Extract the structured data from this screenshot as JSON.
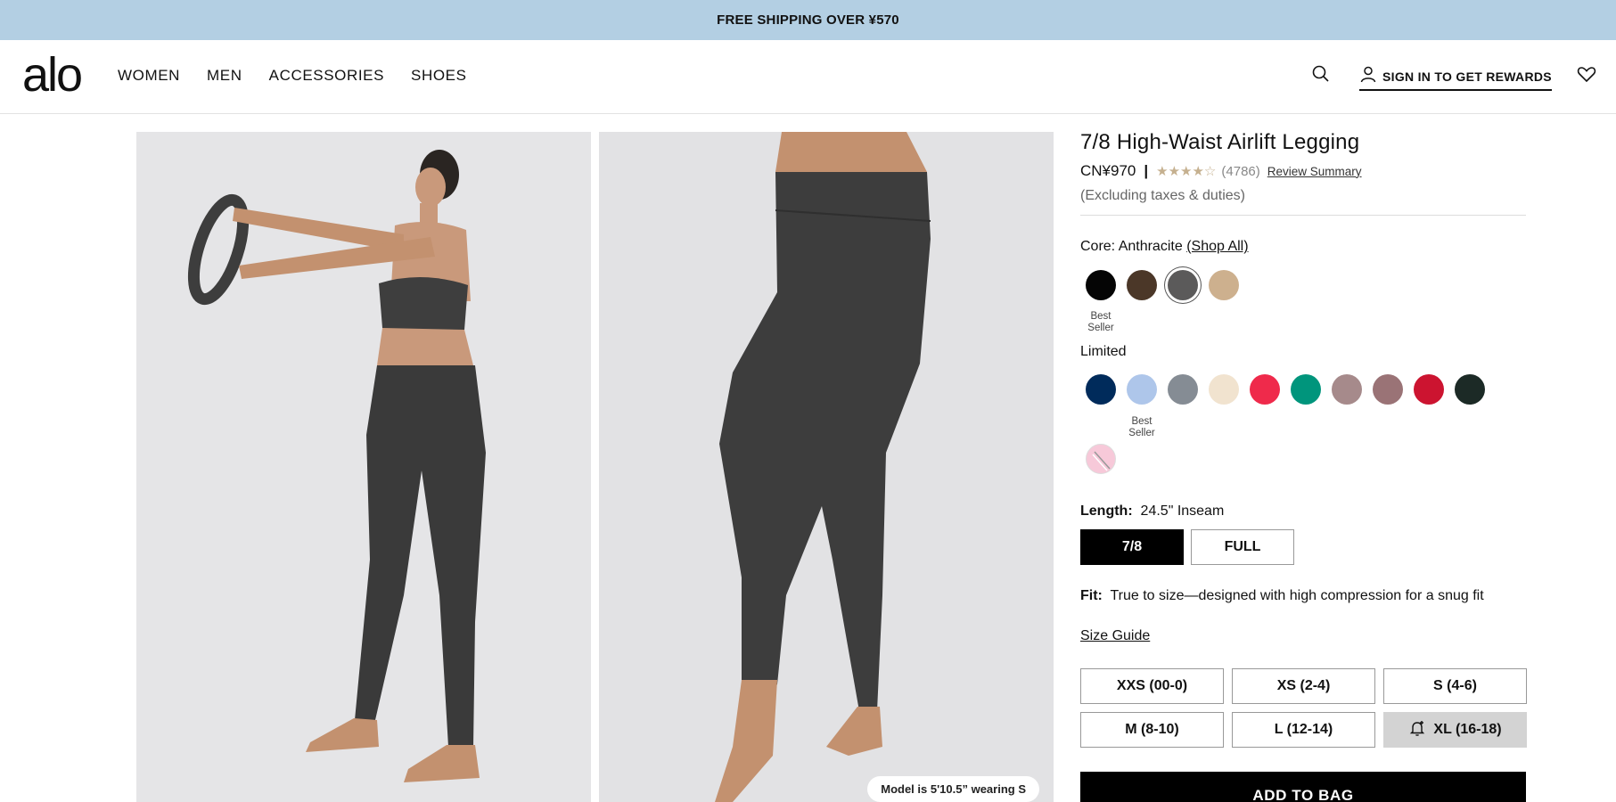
{
  "promo": {
    "text": "FREE SHIPPING OVER ¥570"
  },
  "header": {
    "logo": "alo",
    "nav": [
      "WOMEN",
      "MEN",
      "ACCESSORIES",
      "SHOES"
    ],
    "signin": "SIGN IN TO GET REWARDS"
  },
  "gallery": {
    "model_note": "Model is 5'10.5” wearing S"
  },
  "product": {
    "name": "7/8 High-Waist Airlift Legging",
    "price": "CN¥970",
    "separator": "|",
    "stars": "★★★★☆",
    "review_count": "(4786)",
    "review_summary": "Review Summary",
    "taxes": "(Excluding taxes & duties)",
    "color_prefix": "Core: Anthracite",
    "shop_all": "(Shop All)",
    "best_seller": "Best Seller",
    "limited": "Limited",
    "length_label": "Length:",
    "length_value": "24.5\" Inseam",
    "lengths": [
      "7/8",
      "FULL"
    ],
    "fit_label": "Fit:",
    "fit_value": "True to size—designed with high compression for a snug fit",
    "size_guide": "Size Guide",
    "sizes": [
      "XXS (00-0)",
      "XS (2-4)",
      "S (4-6)",
      "M (8-10)",
      "L (12-14)",
      "XL (16-18)"
    ],
    "add_to_bag": "ADD TO BAG"
  },
  "colors": {
    "core": [
      "#050505",
      "#4b3728",
      "#5b5a5a",
      "#cdb08e"
    ],
    "limited": [
      "#002b5b",
      "#aec6ea",
      "#858c94",
      "#f1e3cf",
      "#ef2a4b",
      "#00957c",
      "#a68a8b",
      "#9a7376",
      "#cc1430",
      "#1c2a26"
    ],
    "limited_extra": "#f7c9d9",
    "accent": "#b3cfe3"
  }
}
